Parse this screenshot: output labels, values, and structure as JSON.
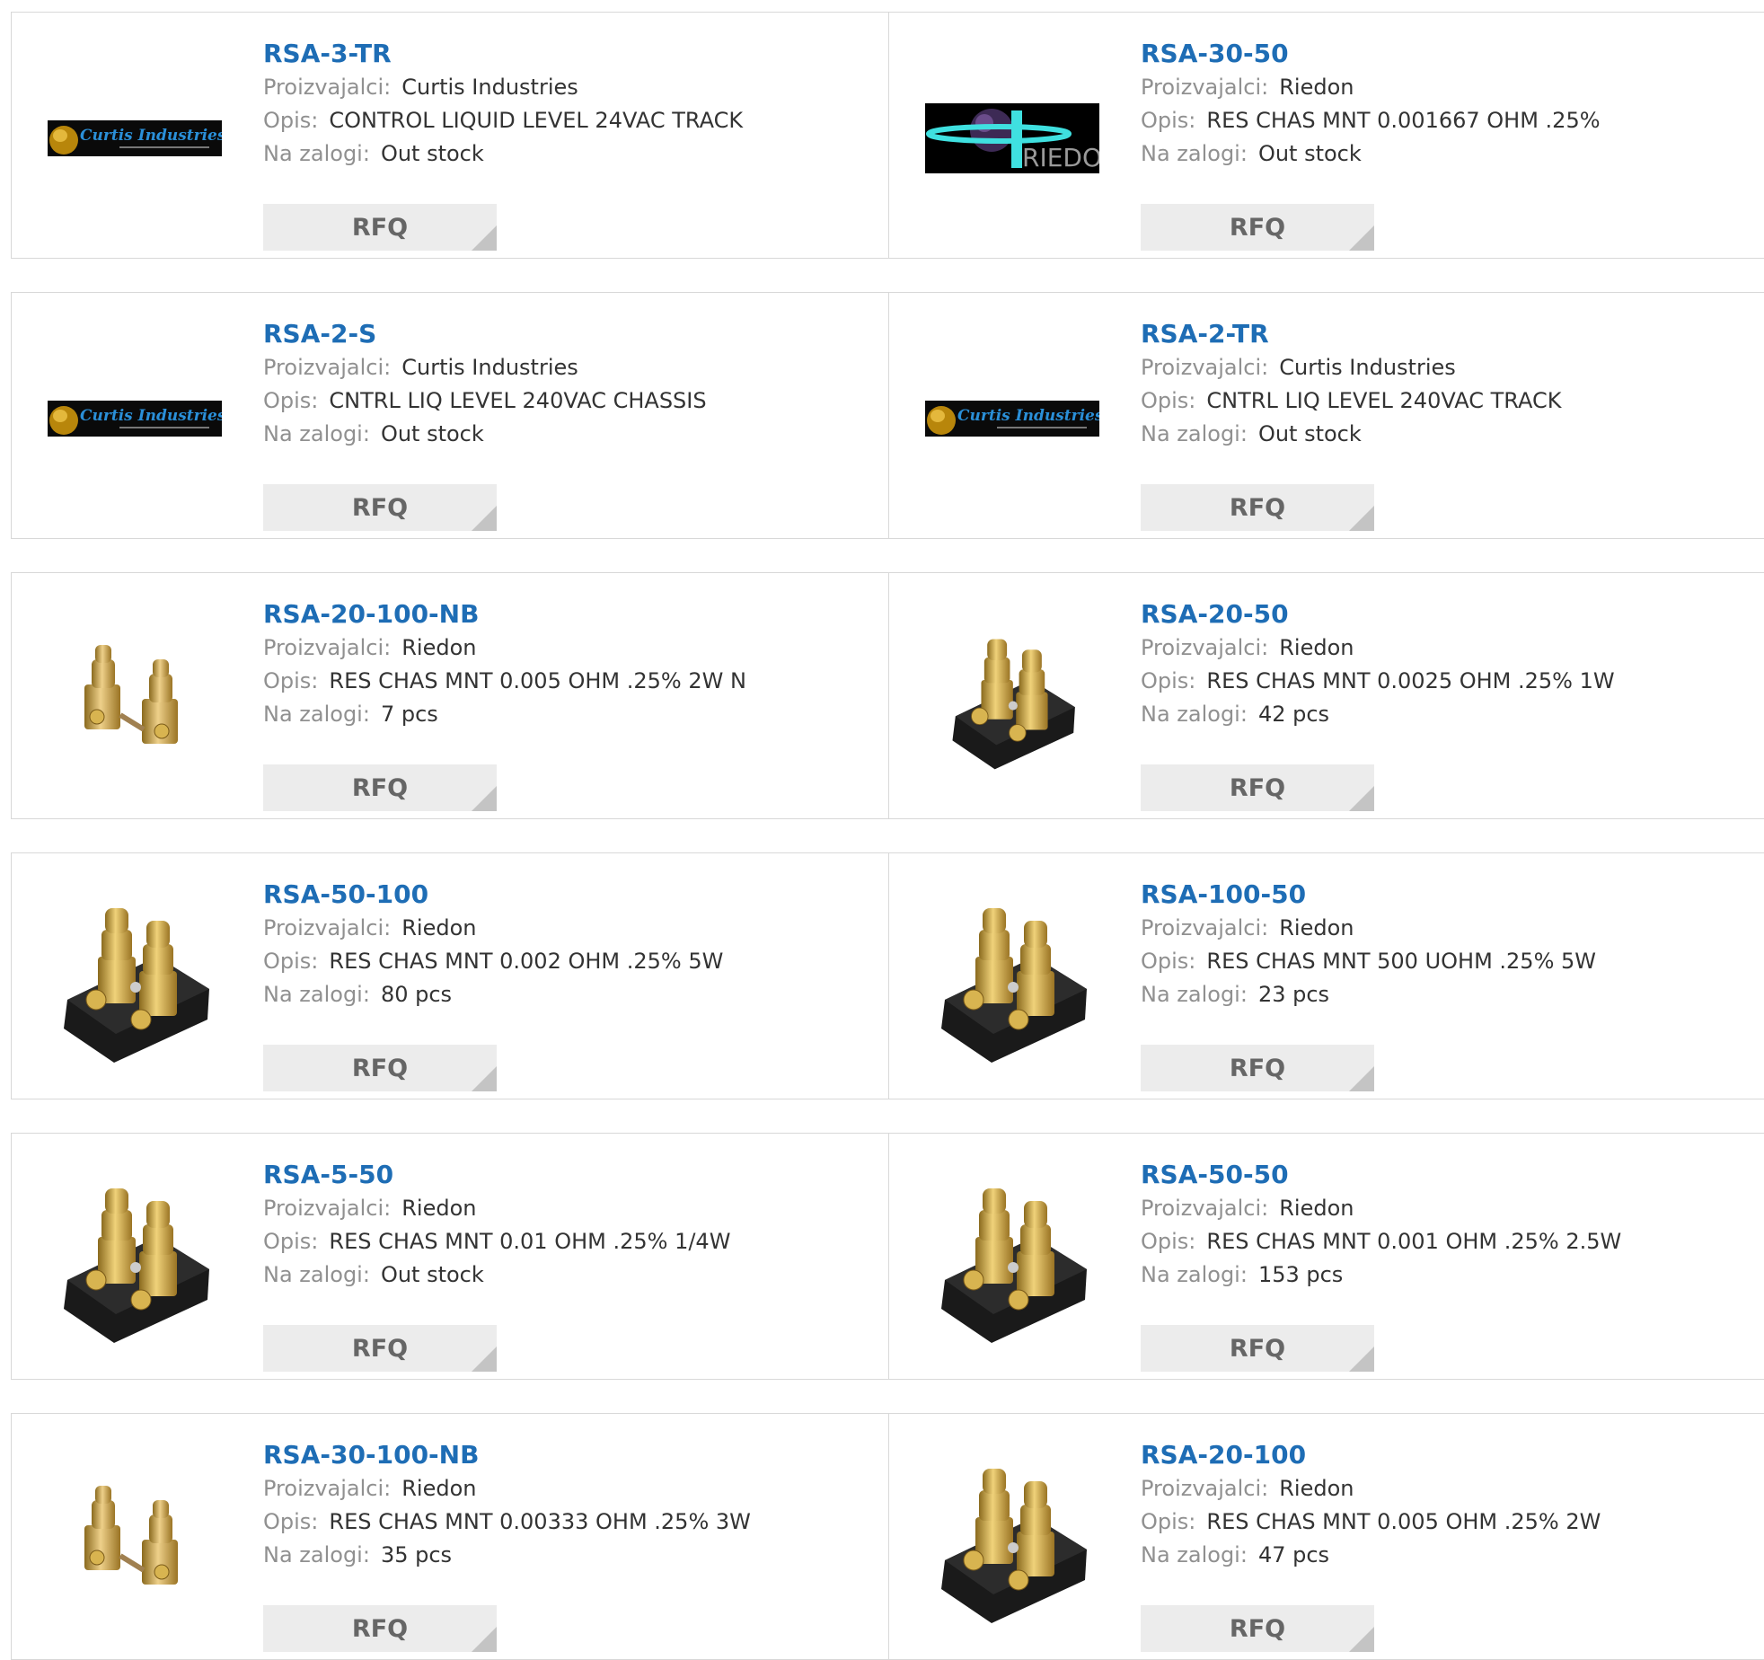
{
  "labels": {
    "manufacturer": "Proizvajalci:",
    "description": "Opis:",
    "stock": "Na zalogi:",
    "rfq": "RFQ"
  },
  "colors": {
    "link": "#1e6db5",
    "label": "#909090",
    "value": "#333333",
    "rfq_bg": "#ececec",
    "rfq_text": "#666666",
    "border": "#d8d8d8"
  },
  "products": [
    {
      "part": "RSA-3-TR",
      "manufacturer": "Curtis Industries",
      "description": "CONTROL LIQUID LEVEL 24VAC TRACK",
      "stock": "Out stock",
      "image": "curtis-logo",
      "logo_text": "Curtis Industries"
    },
    {
      "part": "RSA-30-50",
      "manufacturer": "Riedon",
      "description": "RES CHAS MNT 0.001667 OHM .25%",
      "stock": "Out stock",
      "image": "riedon-logo",
      "logo_text": "RIEDON"
    },
    {
      "part": "RSA-2-S",
      "manufacturer": "Curtis Industries",
      "description": "CNTRL LIQ LEVEL 240VAC CHASSIS",
      "stock": "Out stock",
      "image": "curtis-logo",
      "logo_text": "Curtis Industries"
    },
    {
      "part": "RSA-2-TR",
      "manufacturer": "Curtis Industries",
      "description": "CNTRL LIQ LEVEL 240VAC TRACK",
      "stock": "Out stock",
      "image": "curtis-logo",
      "logo_text": "Curtis Industries"
    },
    {
      "part": "RSA-20-100-NB",
      "manufacturer": "Riedon",
      "description": "RES CHAS MNT 0.005 OHM .25% 2W N",
      "stock": "7 pcs",
      "image": "shunt-no-base"
    },
    {
      "part": "RSA-20-50",
      "manufacturer": "Riedon",
      "description": "RES CHAS MNT 0.0025 OHM .25% 1W",
      "stock": "42 pcs",
      "image": "shunt-small-base"
    },
    {
      "part": "RSA-50-100",
      "manufacturer": "Riedon",
      "description": "RES CHAS MNT 0.002 OHM .25% 5W",
      "stock": "80 pcs",
      "image": "shunt-base"
    },
    {
      "part": "RSA-100-50",
      "manufacturer": "Riedon",
      "description": "RES CHAS MNT 500 UOHM .25% 5W",
      "stock": "23 pcs",
      "image": "shunt-base"
    },
    {
      "part": "RSA-5-50",
      "manufacturer": "Riedon",
      "description": "RES CHAS MNT 0.01 OHM .25% 1/4W",
      "stock": "Out stock",
      "image": "shunt-base"
    },
    {
      "part": "RSA-50-50",
      "manufacturer": "Riedon",
      "description": "RES CHAS MNT 0.001 OHM .25% 2.5W",
      "stock": "153 pcs",
      "image": "shunt-base"
    },
    {
      "part": "RSA-30-100-NB",
      "manufacturer": "Riedon",
      "description": "RES CHAS MNT 0.00333 OHM .25% 3W",
      "stock": "35 pcs",
      "image": "shunt-no-base"
    },
    {
      "part": "RSA-20-100",
      "manufacturer": "Riedon",
      "description": "RES CHAS MNT 0.005 OHM .25% 2W",
      "stock": "47 pcs",
      "image": "shunt-base"
    }
  ]
}
